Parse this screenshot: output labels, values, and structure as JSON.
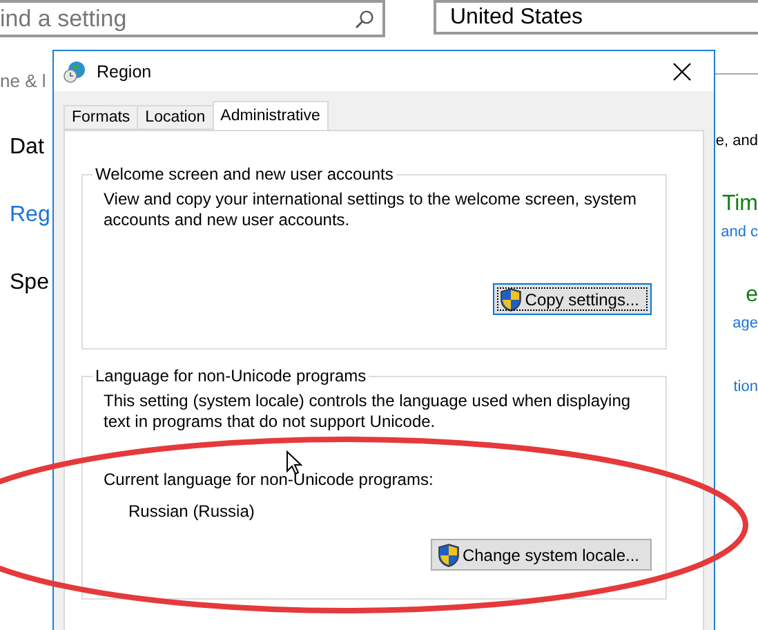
{
  "settings_page": {
    "search": {
      "placeholder": "ind a setting"
    },
    "country_dropdown": {
      "value": "United States"
    },
    "left_items": [
      {
        "label": "ne & l",
        "kind": "heading"
      },
      {
        "label": "Dat",
        "kind": "item",
        "selected": false
      },
      {
        "label": "Reg",
        "kind": "item",
        "selected": true
      },
      {
        "label": "Spe",
        "kind": "item",
        "selected": false
      }
    ],
    "right_items": [
      {
        "text": "e, and",
        "kind": "text"
      },
      {
        "text": "Tim",
        "kind": "heading"
      },
      {
        "text": "and c",
        "kind": "link"
      },
      {
        "text": "e",
        "kind": "heading"
      },
      {
        "text": "age",
        "kind": "link"
      },
      {
        "text": "tion",
        "kind": "link"
      }
    ]
  },
  "dialog": {
    "title": "Region",
    "tabs": [
      {
        "label": "Formats",
        "selected": false
      },
      {
        "label": "Location",
        "selected": false
      },
      {
        "label": "Administrative",
        "selected": true
      }
    ],
    "groups": [
      {
        "title": "Welcome screen and new user accounts",
        "description": "View and copy your international settings to the welcome screen, system accounts and new user accounts.",
        "button": {
          "label": "Copy settings...",
          "focused": true
        }
      },
      {
        "title": "Language for non-Unicode programs",
        "description": "This setting (system locale) controls the language used when displaying text in programs that do not support Unicode.",
        "current_label": "Current language for non-Unicode programs:",
        "current_value": "Russian (Russia)",
        "button": {
          "label": "Change system locale...",
          "focused": false
        }
      }
    ]
  }
}
